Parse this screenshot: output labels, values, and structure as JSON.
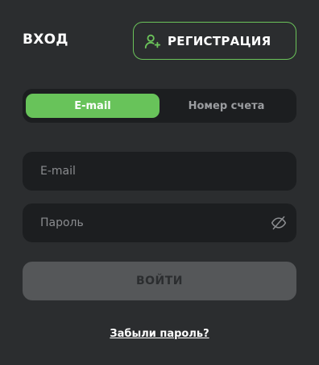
{
  "header": {
    "login_label": "ВХОД",
    "register_label": "РЕГИСТРАЦИЯ",
    "register_icon": "user-plus-icon"
  },
  "tabs": [
    {
      "label": "E-mail",
      "active": true
    },
    {
      "label": "Номер счета",
      "active": false
    }
  ],
  "form": {
    "email_placeholder": "E-mail",
    "email_value": "",
    "password_placeholder": "Пароль",
    "password_value": "",
    "password_toggle_icon": "eye-slash-icon",
    "submit_label": "ВОЙТИ"
  },
  "forgot_password_label": "Забыли пароль?",
  "colors": {
    "background": "#2b2d2f",
    "accent": "#68c35a",
    "field_bg": "#1c1e20",
    "disabled_button": "#555759"
  }
}
